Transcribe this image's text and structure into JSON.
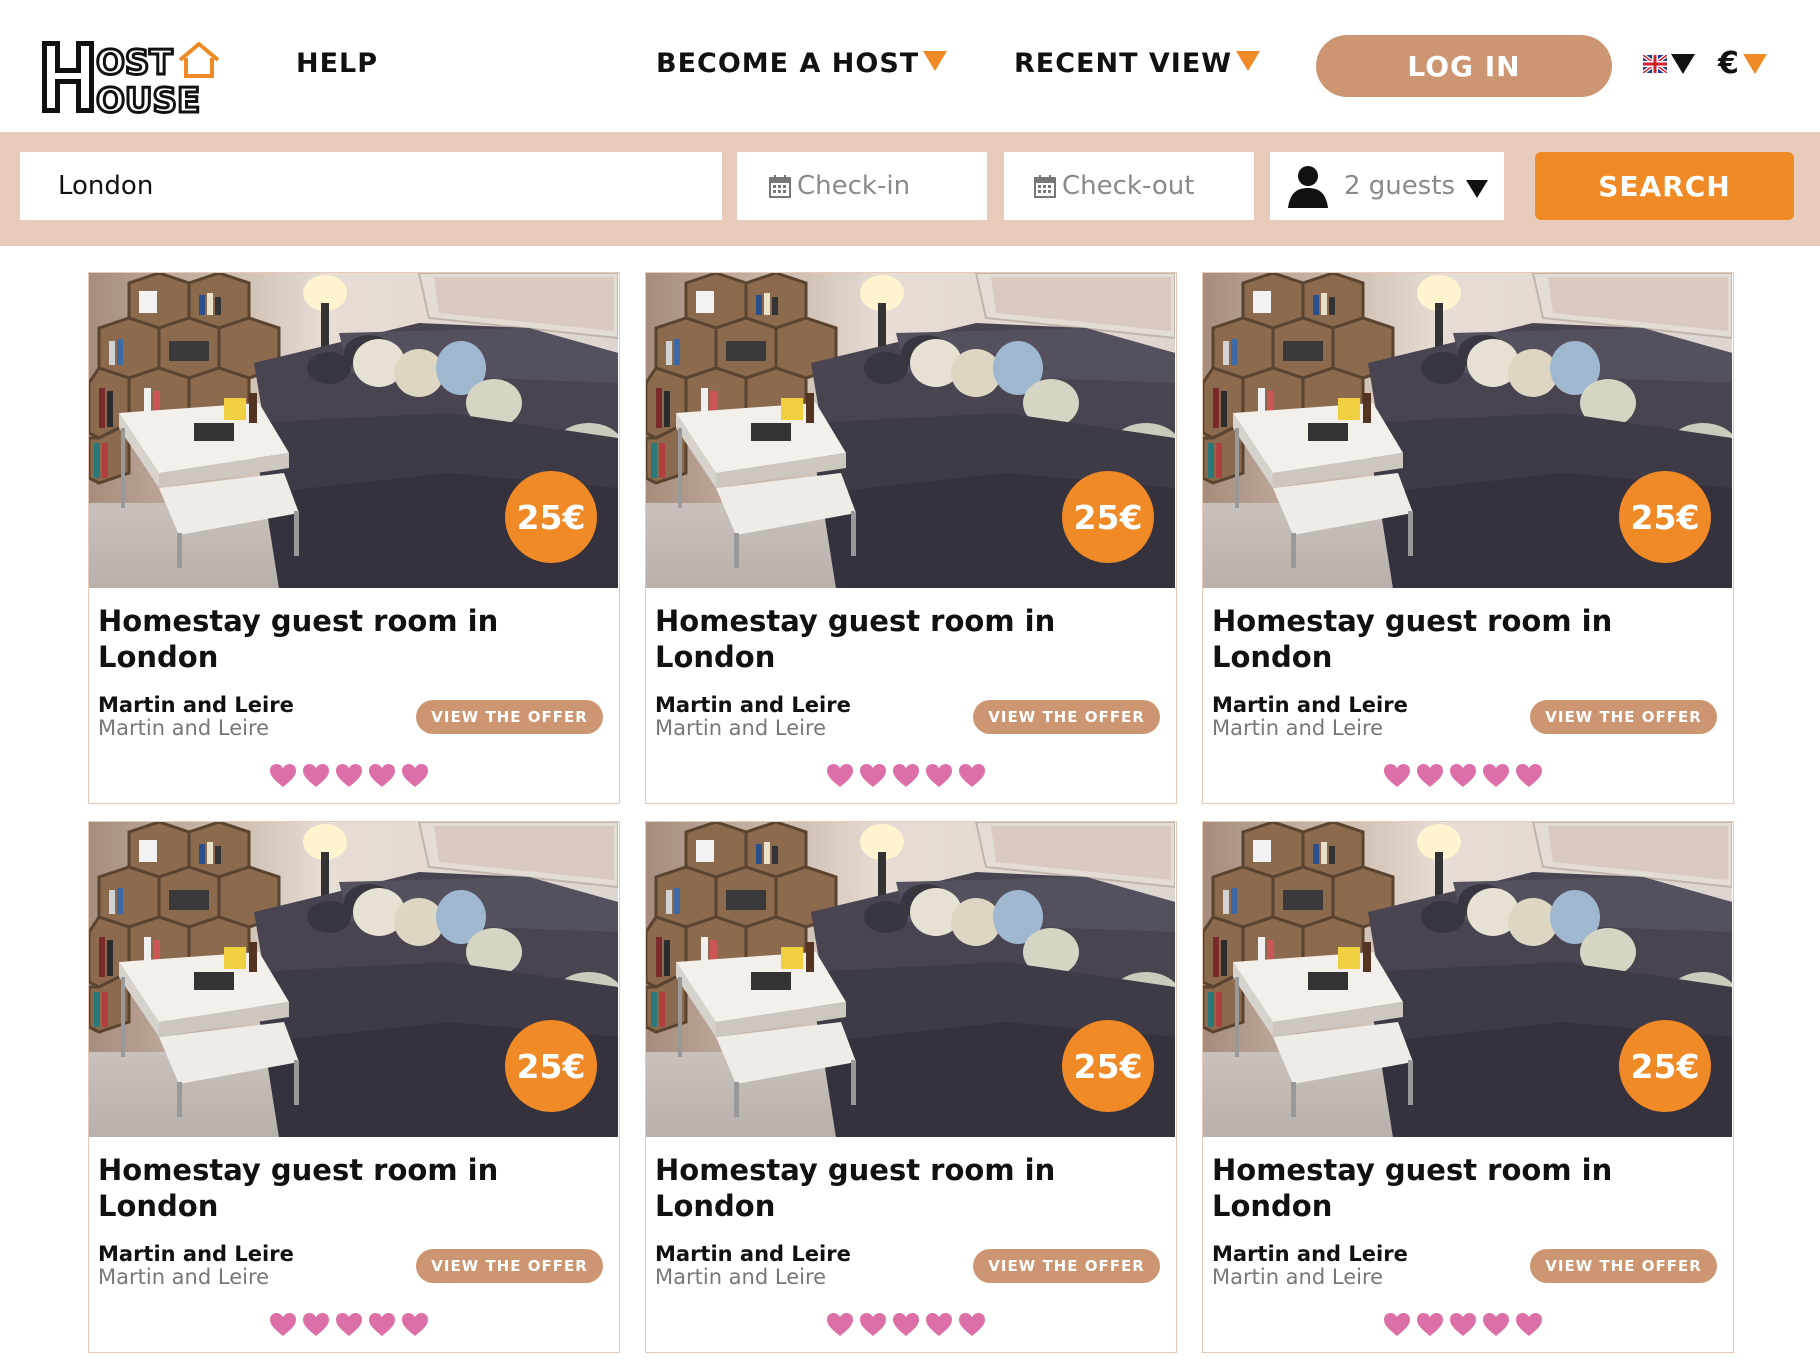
{
  "brand": {
    "logo_text": "HOST HOUSE"
  },
  "nav": {
    "help": "HELP",
    "become_host": "BECOME A HOST",
    "recent_view": "RECENT VIEW",
    "login": "LOG IN",
    "language": "English",
    "currency": "€"
  },
  "search": {
    "location_value": "London",
    "checkin_placeholder": "Check-in",
    "checkout_placeholder": "Check-out",
    "guests_value": "2 guests",
    "button": "SEARCH"
  },
  "colors": {
    "accent_orange": "#ef8a26",
    "button_tan": "#cd9672",
    "searchbar_bg": "#e8cbbb",
    "heart_pink": "#dc6fa8"
  },
  "listings": [
    {
      "title": "Homestay guest room in London",
      "price": "25€",
      "host": "Martin and Leire",
      "subtitle": "Martin and Leire",
      "button": "VIEW THE OFFER",
      "rating": 5
    },
    {
      "title": "Homestay guest room in London",
      "price": "25€",
      "host": "Martin and Leire",
      "subtitle": "Martin and Leire",
      "button": "VIEW THE OFFER",
      "rating": 5
    },
    {
      "title": "Homestay guest room in London",
      "price": "25€",
      "host": "Martin and Leire",
      "subtitle": "Martin and Leire",
      "button": "VIEW THE OFFER",
      "rating": 5
    },
    {
      "title": "Homestay guest room in London",
      "price": "25€",
      "host": "Martin and Leire",
      "subtitle": "Martin and Leire",
      "button": "VIEW THE OFFER",
      "rating": 5
    },
    {
      "title": "Homestay guest room in London",
      "price": "25€",
      "host": "Martin and Leire",
      "subtitle": "Martin and Leire",
      "button": "VIEW THE OFFER",
      "rating": 5
    },
    {
      "title": "Homestay guest room in London",
      "price": "25€",
      "host": "Martin and Leire",
      "subtitle": "Martin and Leire",
      "button": "VIEW THE OFFER",
      "rating": 5
    }
  ]
}
